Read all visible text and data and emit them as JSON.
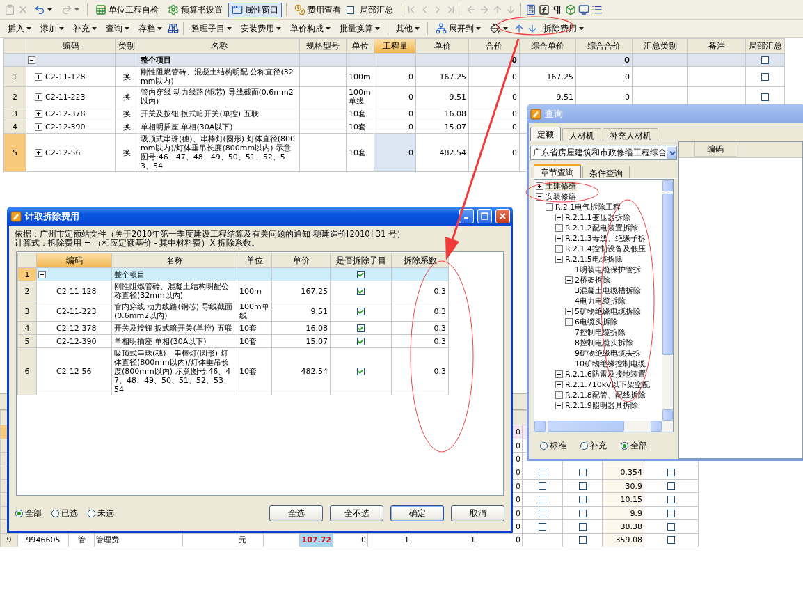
{
  "toolbar_top": [
    {
      "kind": "icon",
      "disabled": true
    },
    {
      "kind": "icon",
      "disabled": true
    },
    {
      "kind": "icon-dropdown",
      "disabled": false
    },
    {
      "kind": "icon-dropdown",
      "disabled": true
    },
    {
      "kind": "separator"
    },
    {
      "kind": "button",
      "label": "单位工程自检",
      "selected": false
    },
    {
      "kind": "button",
      "label": "预算书设置",
      "selected": false
    },
    {
      "kind": "button",
      "label": "属性窗口",
      "selected": true
    },
    {
      "kind": "separator"
    },
    {
      "kind": "button",
      "label": "费用查看",
      "selected": false
    },
    {
      "kind": "checkbox",
      "label": "局部汇总",
      "checked": false
    },
    {
      "kind": "separator"
    },
    {
      "kind": "icon",
      "disabled": true
    },
    {
      "kind": "icon",
      "disabled": true
    },
    {
      "kind": "icon",
      "disabled": true
    },
    {
      "kind": "icon",
      "disabled": true
    },
    {
      "kind": "separator"
    },
    {
      "kind": "icon",
      "disabled": true
    },
    {
      "kind": "icon",
      "disabled": true
    },
    {
      "kind": "icon",
      "disabled": true
    },
    {
      "kind": "icon",
      "disabled": true
    },
    {
      "kind": "separator"
    },
    {
      "kind": "icon",
      "disabled": false
    },
    {
      "kind": "icon",
      "disabled": false
    },
    {
      "kind": "icon",
      "disabled": false
    },
    {
      "kind": "icon",
      "disabled": false
    },
    {
      "kind": "icon",
      "disabled": false
    },
    {
      "kind": "icon",
      "disabled": false
    }
  ],
  "toolbar_bottom": [
    {
      "kind": "menu",
      "label": "插入"
    },
    {
      "kind": "menu",
      "label": "添加"
    },
    {
      "kind": "menu",
      "label": "补充"
    },
    {
      "kind": "menu",
      "label": "查询"
    },
    {
      "kind": "menu",
      "label": "存档"
    },
    {
      "kind": "icon"
    },
    {
      "kind": "separator"
    },
    {
      "kind": "menu",
      "label": "整理子目"
    },
    {
      "kind": "menu",
      "label": "安装费用"
    },
    {
      "kind": "menu",
      "label": "单价构成"
    },
    {
      "kind": "menu",
      "label": "批量换算"
    },
    {
      "kind": "separator"
    },
    {
      "kind": "menu",
      "label": "其他"
    },
    {
      "kind": "separator"
    },
    {
      "kind": "menu",
      "label": "展开到"
    },
    {
      "kind": "icon-dropdown"
    },
    {
      "kind": "icon"
    },
    {
      "kind": "icon"
    },
    {
      "kind": "menu",
      "label": "拆除费用"
    }
  ],
  "main_table": {
    "columns": [
      {
        "label": "编码",
        "selected": false
      },
      {
        "label": "类别",
        "selected": false
      },
      {
        "label": "名称",
        "selected": false
      },
      {
        "label": "规格型号",
        "selected": false
      },
      {
        "label": "单位",
        "selected": false
      },
      {
        "label": "工程量",
        "selected": true
      },
      {
        "label": "单价",
        "selected": false
      },
      {
        "label": "合价",
        "selected": false
      },
      {
        "label": "综合单价",
        "selected": false
      },
      {
        "label": "综合合价",
        "selected": false
      },
      {
        "label": "汇总类别",
        "selected": false
      },
      {
        "label": "备注",
        "selected": false
      },
      {
        "label": "局部汇总",
        "selected": false
      }
    ],
    "rows": [
      {
        "kind": "group",
        "expanded": true,
        "selected": false,
        "name": "整个项目",
        "total": "0",
        "composite_total": "0",
        "partial_summary": false
      },
      {
        "kind": "item",
        "expanded": false,
        "selected": false,
        "number": "1",
        "code": "C2-11-128",
        "type": "换",
        "name": "刚性阻燃管砖、混凝土结构明配 公称直径(32mm以内)",
        "unit": "100m",
        "quantity": "0",
        "price": "167.25",
        "total": "0",
        "composite_price": "167.25",
        "composite_total": "0",
        "partial_summary": false
      },
      {
        "kind": "item",
        "expanded": false,
        "selected": false,
        "number": "2",
        "code": "C2-11-223",
        "type": "换",
        "name": "管内穿线 动力线路(铜芯) 导线截面(0.6mm2以内)",
        "unit": "100m单线",
        "quantity": "0",
        "price": "9.51",
        "total": "0",
        "composite_price": "9.51",
        "composite_total": "0",
        "partial_summary": false
      },
      {
        "kind": "item",
        "expanded": false,
        "selected": false,
        "number": "3",
        "code": "C2-12-378",
        "type": "换",
        "name": "开关及按钮 扳式暗开关(单控) 五联",
        "unit": "10套",
        "quantity": "0",
        "price": "16.08",
        "total": "0"
      },
      {
        "kind": "item",
        "expanded": false,
        "selected": false,
        "number": "4",
        "code": "C2-12-390",
        "type": "换",
        "name": "单相明插座 单相(30A以下)",
        "unit": "10套",
        "quantity": "0",
        "price": "15.07",
        "total": "0"
      },
      {
        "kind": "item",
        "expanded": false,
        "selected": true,
        "number": "5",
        "code": "C2-12-56",
        "type": "换",
        "name": "吸顶式串珠(穗)、串棒灯(圆形) 灯体直径(800mm以内)/灯体垂吊长度(800mm以内) 示意图号:46、47、48、49、50、51、52、53、54",
        "unit": "10套",
        "quantity": "0",
        "price": "482.54",
        "total": "0"
      }
    ]
  },
  "lower_table": {
    "rows": [
      {
        "selected": true,
        "column_12": "0"
      },
      {
        "selected": false,
        "column_12": "0"
      },
      {
        "selected": false,
        "column_12": "0"
      },
      {
        "selected": false,
        "column_12": "0",
        "column_13": false,
        "column_14": false,
        "column_15": "0.354",
        "column_16": false
      },
      {
        "selected": false,
        "column_12": "0",
        "column_13": false,
        "column_14": false,
        "column_15": "30.9",
        "column_16": false
      },
      {
        "selected": false,
        "column_12": "0",
        "column_13": false,
        "column_14": false,
        "column_15": "10.15",
        "column_16": false
      },
      {
        "selected": false,
        "column_12": "0",
        "column_13": false,
        "column_14": false,
        "column_15": "9.9",
        "column_16": false
      },
      {
        "selected": false,
        "column_12": "0",
        "column_13": false,
        "column_14": false,
        "column_15": "38.38",
        "column_16": false
      },
      {
        "selected": false,
        "modified": true,
        "column_1": "9",
        "column_2": "9946605",
        "column_3": "管",
        "column_4": "管理费",
        "column_6": "元",
        "column_8": "107.72",
        "column_9": "0",
        "column_10": "1",
        "column_11": "1",
        "column_12": "0",
        "column_14": false,
        "column_15": "359.08",
        "column_16": false
      }
    ]
  },
  "removal_dialog": {
    "title": "计取拆除费用",
    "basis": "依据：广州市定额站文件（关于2010年第一季度建设工程结算及有关问题的通知 穗建造价[2010] 31 号）",
    "formula": "计算式：拆除费用 = （相应定额基价 - 其中材料费）X 拆除系数。",
    "columns": [
      {
        "label": "编码",
        "selected": true
      },
      {
        "label": "名称",
        "selected": false
      },
      {
        "label": "单位",
        "selected": false
      },
      {
        "label": "单价",
        "selected": false
      },
      {
        "label": "是否拆除子目",
        "selected": false
      },
      {
        "label": "拆除系数",
        "selected": false
      }
    ],
    "rows": [
      {
        "kind": "group",
        "expanded": true,
        "selected": true,
        "number": "1",
        "name": "整个项目",
        "remove": true
      },
      {
        "kind": "item",
        "selected": false,
        "number": "2",
        "code": "C2-11-128",
        "name": "刚性阻燃管砖、混凝土结构明配公称直径(32mm以内)",
        "unit": "100m",
        "price": "167.25",
        "remove": true,
        "coefficient": "0.3"
      },
      {
        "kind": "item",
        "selected": false,
        "number": "3",
        "code": "C2-11-223",
        "name": "管内穿线 动力线路(铜芯) 导线截面(0.6mm2以内)",
        "unit": "100m单线",
        "price": "9.51",
        "remove": true,
        "coefficient": "0.3"
      },
      {
        "kind": "item",
        "selected": false,
        "number": "4",
        "code": "C2-12-378",
        "name": "开关及按钮 扳式暗开关(单控) 五联",
        "unit": "10套",
        "price": "16.08",
        "remove": true,
        "coefficient": "0.3"
      },
      {
        "kind": "item",
        "selected": false,
        "number": "5",
        "code": "C2-12-390",
        "name": "单相明插座 单相(30A以下)",
        "unit": "10套",
        "price": "15.07",
        "remove": true,
        "coefficient": "0.3"
      },
      {
        "kind": "item",
        "selected": false,
        "number": "6",
        "code": "C2-12-56",
        "name": "吸顶式串珠(穗)、串棒灯(圆形) 灯体直径(800mm以内)/灯体垂吊长度(800mm以内) 示意图号:46、47、48、49、50、51、52、53、54",
        "unit": "10套",
        "price": "482.54",
        "remove": true,
        "coefficient": "0.3"
      }
    ],
    "filters": [
      {
        "label": "全部",
        "selected": true
      },
      {
        "label": "已选",
        "selected": false
      },
      {
        "label": "未选",
        "selected": false
      }
    ],
    "buttons": [
      {
        "label": "全选",
        "default": false
      },
      {
        "label": "全不选",
        "default": false
      },
      {
        "label": "确定",
        "default": true
      },
      {
        "label": "取消",
        "default": false
      }
    ]
  },
  "query_panel": {
    "title": "查询",
    "tabs": [
      {
        "label": "定额",
        "selected": true
      },
      {
        "label": "人材机",
        "selected": false
      },
      {
        "label": "补充人材机",
        "selected": false
      }
    ],
    "library": "广东省房屋建筑和市政修缮工程综合",
    "subtabs": [
      {
        "label": "章节查询",
        "selected": true
      },
      {
        "label": "条件查询",
        "selected": false
      }
    ],
    "tree": [
      {
        "kind": "node",
        "label": "土建修缮",
        "expanded": false,
        "selected": true
      },
      {
        "kind": "node",
        "label": "安装修缮",
        "expanded": true,
        "selected": false,
        "children": [
          {
            "kind": "node",
            "label": "R.2.1电气拆除工程",
            "expanded": true,
            "selected": false,
            "children": [
              {
                "kind": "node",
                "label": "R.2.1.1变压器拆除",
                "expanded": false,
                "selected": false
              },
              {
                "kind": "node",
                "label": "R.2.1.2配电装置拆除",
                "expanded": false,
                "selected": false
              },
              {
                "kind": "node",
                "label": "R.2.1.3母线、绝缘子拆",
                "expanded": false,
                "selected": false
              },
              {
                "kind": "node",
                "label": "R.2.1.4控制设备及低压",
                "expanded": false,
                "selected": false
              },
              {
                "kind": "node",
                "label": "R.2.1.5电缆拆除",
                "expanded": true,
                "selected": false,
                "children": [
                  {
                    "kind": "leaf",
                    "label": "1明装电缆保护管拆",
                    "selected": false
                  },
                  {
                    "kind": "node",
                    "label": "2桥架拆除",
                    "expanded": false,
                    "selected": false
                  },
                  {
                    "kind": "leaf",
                    "label": "3混凝土电缆槽拆除",
                    "selected": false
                  },
                  {
                    "kind": "leaf",
                    "label": "4电力电缆拆除",
                    "selected": false
                  },
                  {
                    "kind": "node",
                    "label": "5矿物绝缘电缆拆除",
                    "expanded": false,
                    "selected": false
                  },
                  {
                    "kind": "node",
                    "label": "6电缆头拆除",
                    "expanded": false,
                    "selected": false
                  },
                  {
                    "kind": "leaf",
                    "label": "7控制电缆拆除",
                    "selected": false
                  },
                  {
                    "kind": "leaf",
                    "label": "8控制电缆头拆除",
                    "selected": false
                  },
                  {
                    "kind": "leaf",
                    "label": "9矿物绝缘电缆头拆",
                    "selected": false
                  },
                  {
                    "kind": "leaf",
                    "label": "10矿物绝缘控制电缆",
                    "selected": false
                  }
                ]
              },
              {
                "kind": "node",
                "label": "R.2.1.6防雷及接地装置",
                "expanded": false,
                "selected": false
              },
              {
                "kind": "node",
                "label": "R.2.1.710kV以下架空配",
                "expanded": false,
                "selected": false
              },
              {
                "kind": "node",
                "label": "R.2.1.8配管、配线拆除",
                "expanded": false,
                "selected": false
              },
              {
                "kind": "node",
                "label": "R.2.1.9照明器具拆除",
                "expanded": false,
                "selected": false
              }
            ]
          }
        ]
      }
    ],
    "filters": [
      {
        "label": "标准",
        "selected": false
      },
      {
        "label": "补充",
        "selected": false
      },
      {
        "label": "全部",
        "selected": true
      }
    ],
    "result_columns": [
      "编码"
    ]
  }
}
